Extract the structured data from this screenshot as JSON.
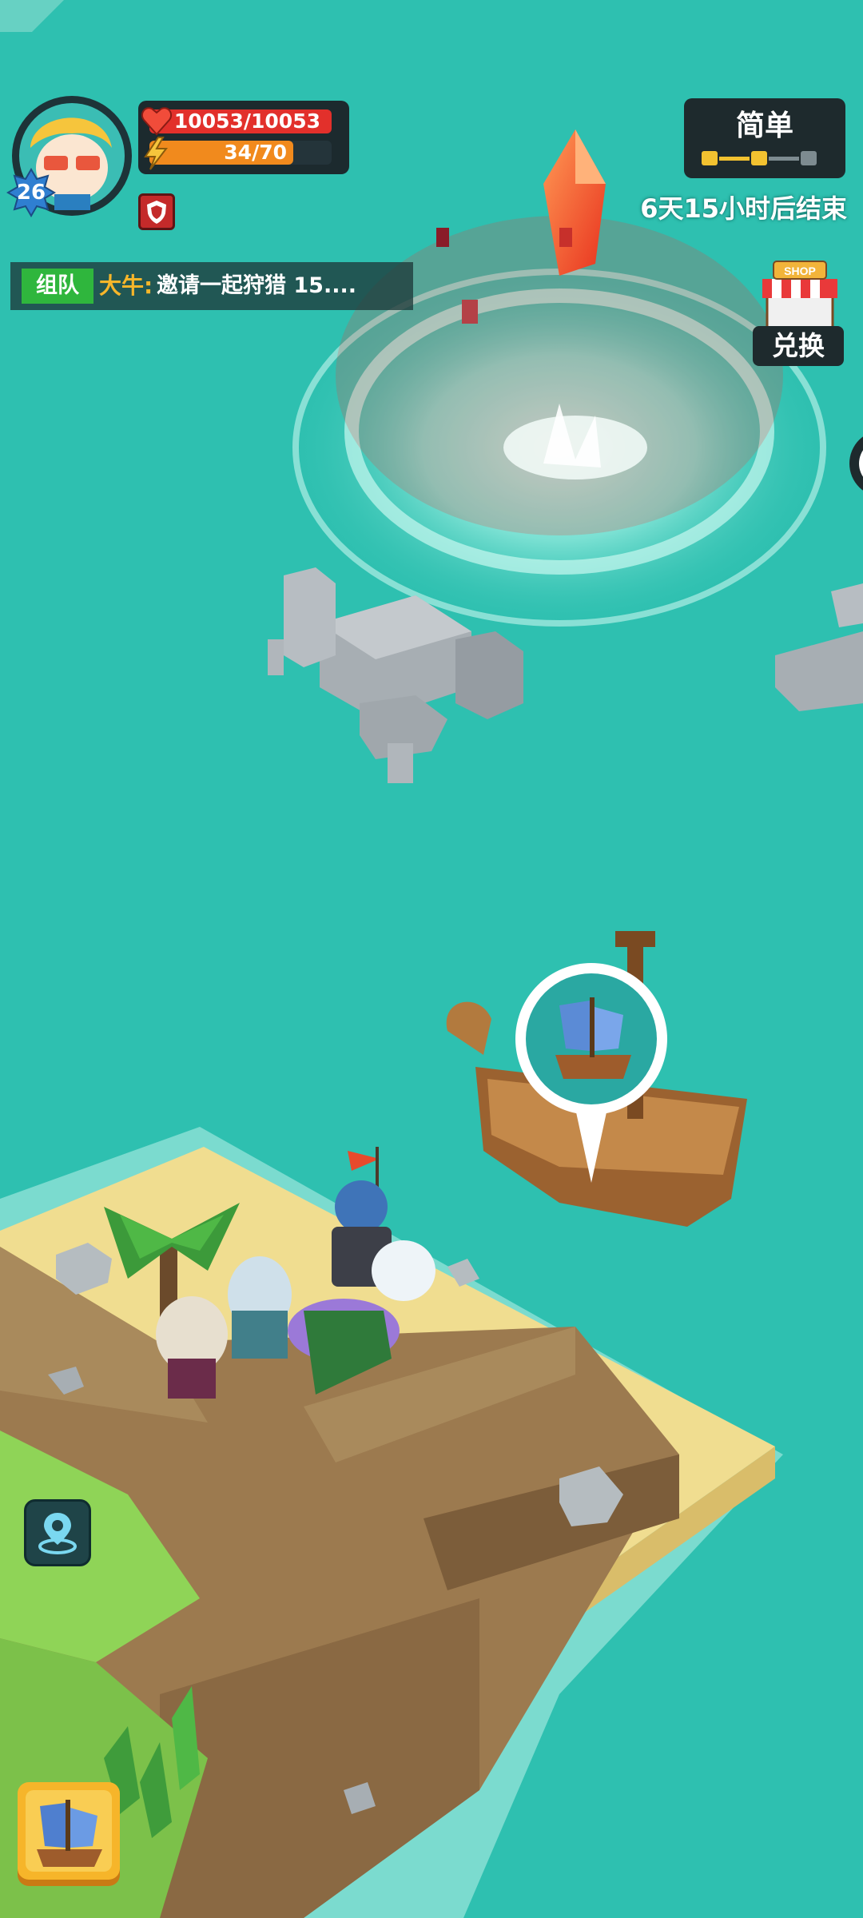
{
  "player": {
    "level": "26",
    "hp": "10053/10053",
    "hp_fraction": 1.0,
    "energy": "34/70",
    "energy_fraction": 0.486,
    "status_icon": "shield-icon"
  },
  "team_chat": {
    "tag": "组队",
    "speaker": "大牛:",
    "message": "邀请一起狩猎 15...."
  },
  "difficulty": {
    "label": "简单",
    "level_count": 3,
    "current": 2
  },
  "event": {
    "countdown": "6天15小时后结束"
  },
  "shop": {
    "sign_text": "SHOP",
    "label": "兑换"
  },
  "buttons": {
    "locate_icon": "location-pin-icon",
    "ship_icon": "ship-icon"
  },
  "colors": {
    "sea": "#2ec0b0",
    "hp": "#e2302b",
    "energy": "#f18a1d",
    "team_tag": "#2fb63d",
    "speaker": "#f6b62a",
    "panel": "#1e2a2d"
  }
}
